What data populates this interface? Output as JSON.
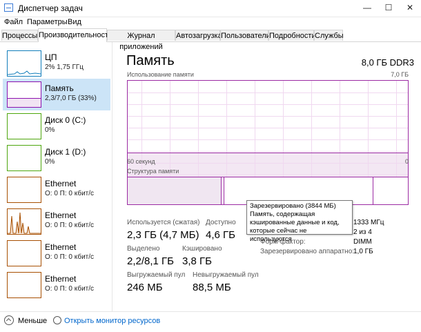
{
  "window": {
    "title": "Диспетчер задач",
    "controls": [
      "—",
      "☐",
      "✕"
    ]
  },
  "menu": [
    "Файл",
    "Параметры",
    "Вид"
  ],
  "tabs": [
    "Процессы",
    "Производительность",
    "Журнал приложений",
    "Автозагрузка",
    "Пользователи",
    "Подробности",
    "Службы"
  ],
  "sidebar": {
    "items": [
      {
        "title": "ЦП",
        "subtitle": "2% 1,75 ГГц",
        "color": "#117dbb"
      },
      {
        "title": "Память",
        "subtitle": "2,3/7,0 ГБ (33%)",
        "color": "#8b12ae"
      },
      {
        "title": "Диск 0 (C:)",
        "subtitle": "0%",
        "color": "#4da60c"
      },
      {
        "title": "Диск 1 (D:)",
        "subtitle": "0%",
        "color": "#4da60c"
      },
      {
        "title": "Ethernet",
        "subtitle": "О: 0 П: 0 кбит/с",
        "color": "#a74f01"
      },
      {
        "title": "Ethernet",
        "subtitle": "О: 0 П: 0 кбит/с",
        "color": "#a74f01"
      },
      {
        "title": "Ethernet",
        "subtitle": "О: 0 П: 0 кбит/с",
        "color": "#a74f01"
      },
      {
        "title": "Ethernet",
        "subtitle": "О: 0 П: 0 кбит/с",
        "color": "#a74f01"
      }
    ]
  },
  "main": {
    "title": "Память",
    "total": "8,0 ГБ DDR3",
    "usage_label": "Использование памяти",
    "usage_max": "7,0 ГБ",
    "time_left": "60 секунд",
    "time_right": "0",
    "structure_label": "Структура памяти",
    "stats": {
      "in_use_label": "Используется (сжатая)",
      "in_use_value": "2,3 ГБ (4,7 МБ)",
      "available_label": "Доступно",
      "available_value": "4,6 ГБ",
      "committed_label": "Выделено",
      "committed_value": "2,2/8,1 ГБ",
      "cached_label": "Кэшировано",
      "cached_value": "3,8 ГБ",
      "paged_label": "Выгружаемый пул",
      "paged_value": "246 МБ",
      "nonpaged_label": "Невыгружаемый пул",
      "nonpaged_value": "88,5 МБ"
    },
    "right": {
      "speed_value": "1333 МГц",
      "slots_value": "2 из 4",
      "form_label": "Форм-фактор:",
      "form_value": "DIMM",
      "hw_label": "Зарезервировано аппаратно:",
      "hw_value": "1,0 ГБ"
    },
    "tooltip": {
      "title": "Зарезервировано (3844 МБ)",
      "line1": "Память, содержащая",
      "line2": "кэшированные данные и код,",
      "line3": "которые сейчас не используются"
    }
  },
  "footer": {
    "less": "Меньше",
    "monitor": "Открыть монитор ресурсов"
  },
  "chart_data": {
    "type": "area",
    "title": "",
    "ylabel": "Использование памяти",
    "ylim": [
      0,
      7.0
    ],
    "x": [
      60,
      50,
      40,
      30,
      20,
      10,
      0
    ],
    "series": [
      {
        "values": [
          2.3,
          2.3,
          2.3,
          2.3,
          2.3,
          2.3,
          2.3
        ]
      }
    ]
  }
}
